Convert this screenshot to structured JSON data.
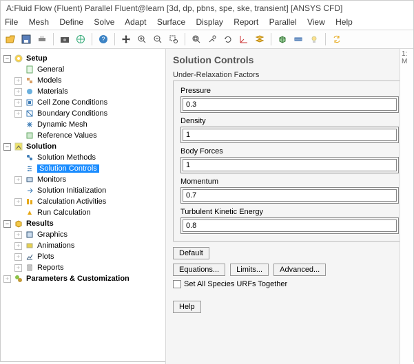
{
  "title": "A:Fluid Flow (Fluent) Parallel Fluent@learn  [3d, dp, pbns, spe, ske, transient] [ANSYS CFD]",
  "menu": {
    "file": "File",
    "mesh": "Mesh",
    "define": "Define",
    "solve": "Solve",
    "adapt": "Adapt",
    "surface": "Surface",
    "display": "Display",
    "report": "Report",
    "parallel": "Parallel",
    "view": "View",
    "help": "Help"
  },
  "tree": {
    "setup": {
      "label": "Setup",
      "items": {
        "general": "General",
        "models": "Models",
        "materials": "Materials",
        "czc": "Cell Zone Conditions",
        "bc": "Boundary Conditions",
        "dm": "Dynamic Mesh",
        "rv": "Reference Values"
      }
    },
    "solution": {
      "label": "Solution",
      "items": {
        "sm": "Solution Methods",
        "sc": "Solution Controls",
        "mon": "Monitors",
        "si": "Solution Initialization",
        "ca": "Calculation Activities",
        "rc": "Run Calculation"
      }
    },
    "results": {
      "label": "Results",
      "items": {
        "gfx": "Graphics",
        "anim": "Animations",
        "plots": "Plots",
        "rep": "Reports"
      }
    },
    "pc": {
      "label": "Parameters & Customization"
    }
  },
  "panel": {
    "title": "Solution Controls",
    "group_label": "Under-Relaxation Factors",
    "fields": {
      "pressure": {
        "label": "Pressure",
        "value": "0.3"
      },
      "density": {
        "label": "Density",
        "value": "1"
      },
      "body_forces": {
        "label": "Body Forces",
        "value": "1"
      },
      "momentum": {
        "label": "Momentum",
        "value": "0.7"
      },
      "tke": {
        "label": "Turbulent Kinetic Energy",
        "value": "0.8"
      }
    },
    "buttons": {
      "default": "Default",
      "equations": "Equations...",
      "limits": "Limits...",
      "advanced": "Advanced...",
      "help": "Help"
    },
    "chk": "Set All Species URFs Together"
  },
  "right_tab": "1: M"
}
